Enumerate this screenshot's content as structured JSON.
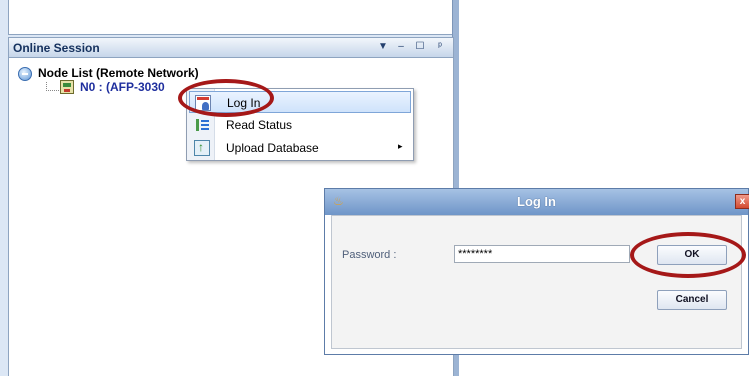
{
  "panel": {
    "title": "Online Session",
    "header_buttons": {
      "dropdown": "▼",
      "minimize": "‒",
      "maximize": "☐",
      "pin": "ᵖ"
    },
    "tree": {
      "root_label": "Node List (Remote Network)",
      "node_label": "N0 : (AFP-3030"
    }
  },
  "context_menu": {
    "items": [
      {
        "label": "Log In",
        "icon": "login-icon",
        "highlighted": true
      },
      {
        "label": "Read Status",
        "icon": "status-list-icon"
      },
      {
        "label": "Upload Database",
        "icon": "upload-icon",
        "submenu_arrow": "▸"
      }
    ]
  },
  "dialog": {
    "title": "Log In",
    "close_glyph": "x",
    "app_icon": "♨",
    "password_label": "Password :",
    "password_value": "********",
    "ok_label": "OK",
    "cancel_label": "Cancel"
  },
  "annotation_color": "#a51818"
}
